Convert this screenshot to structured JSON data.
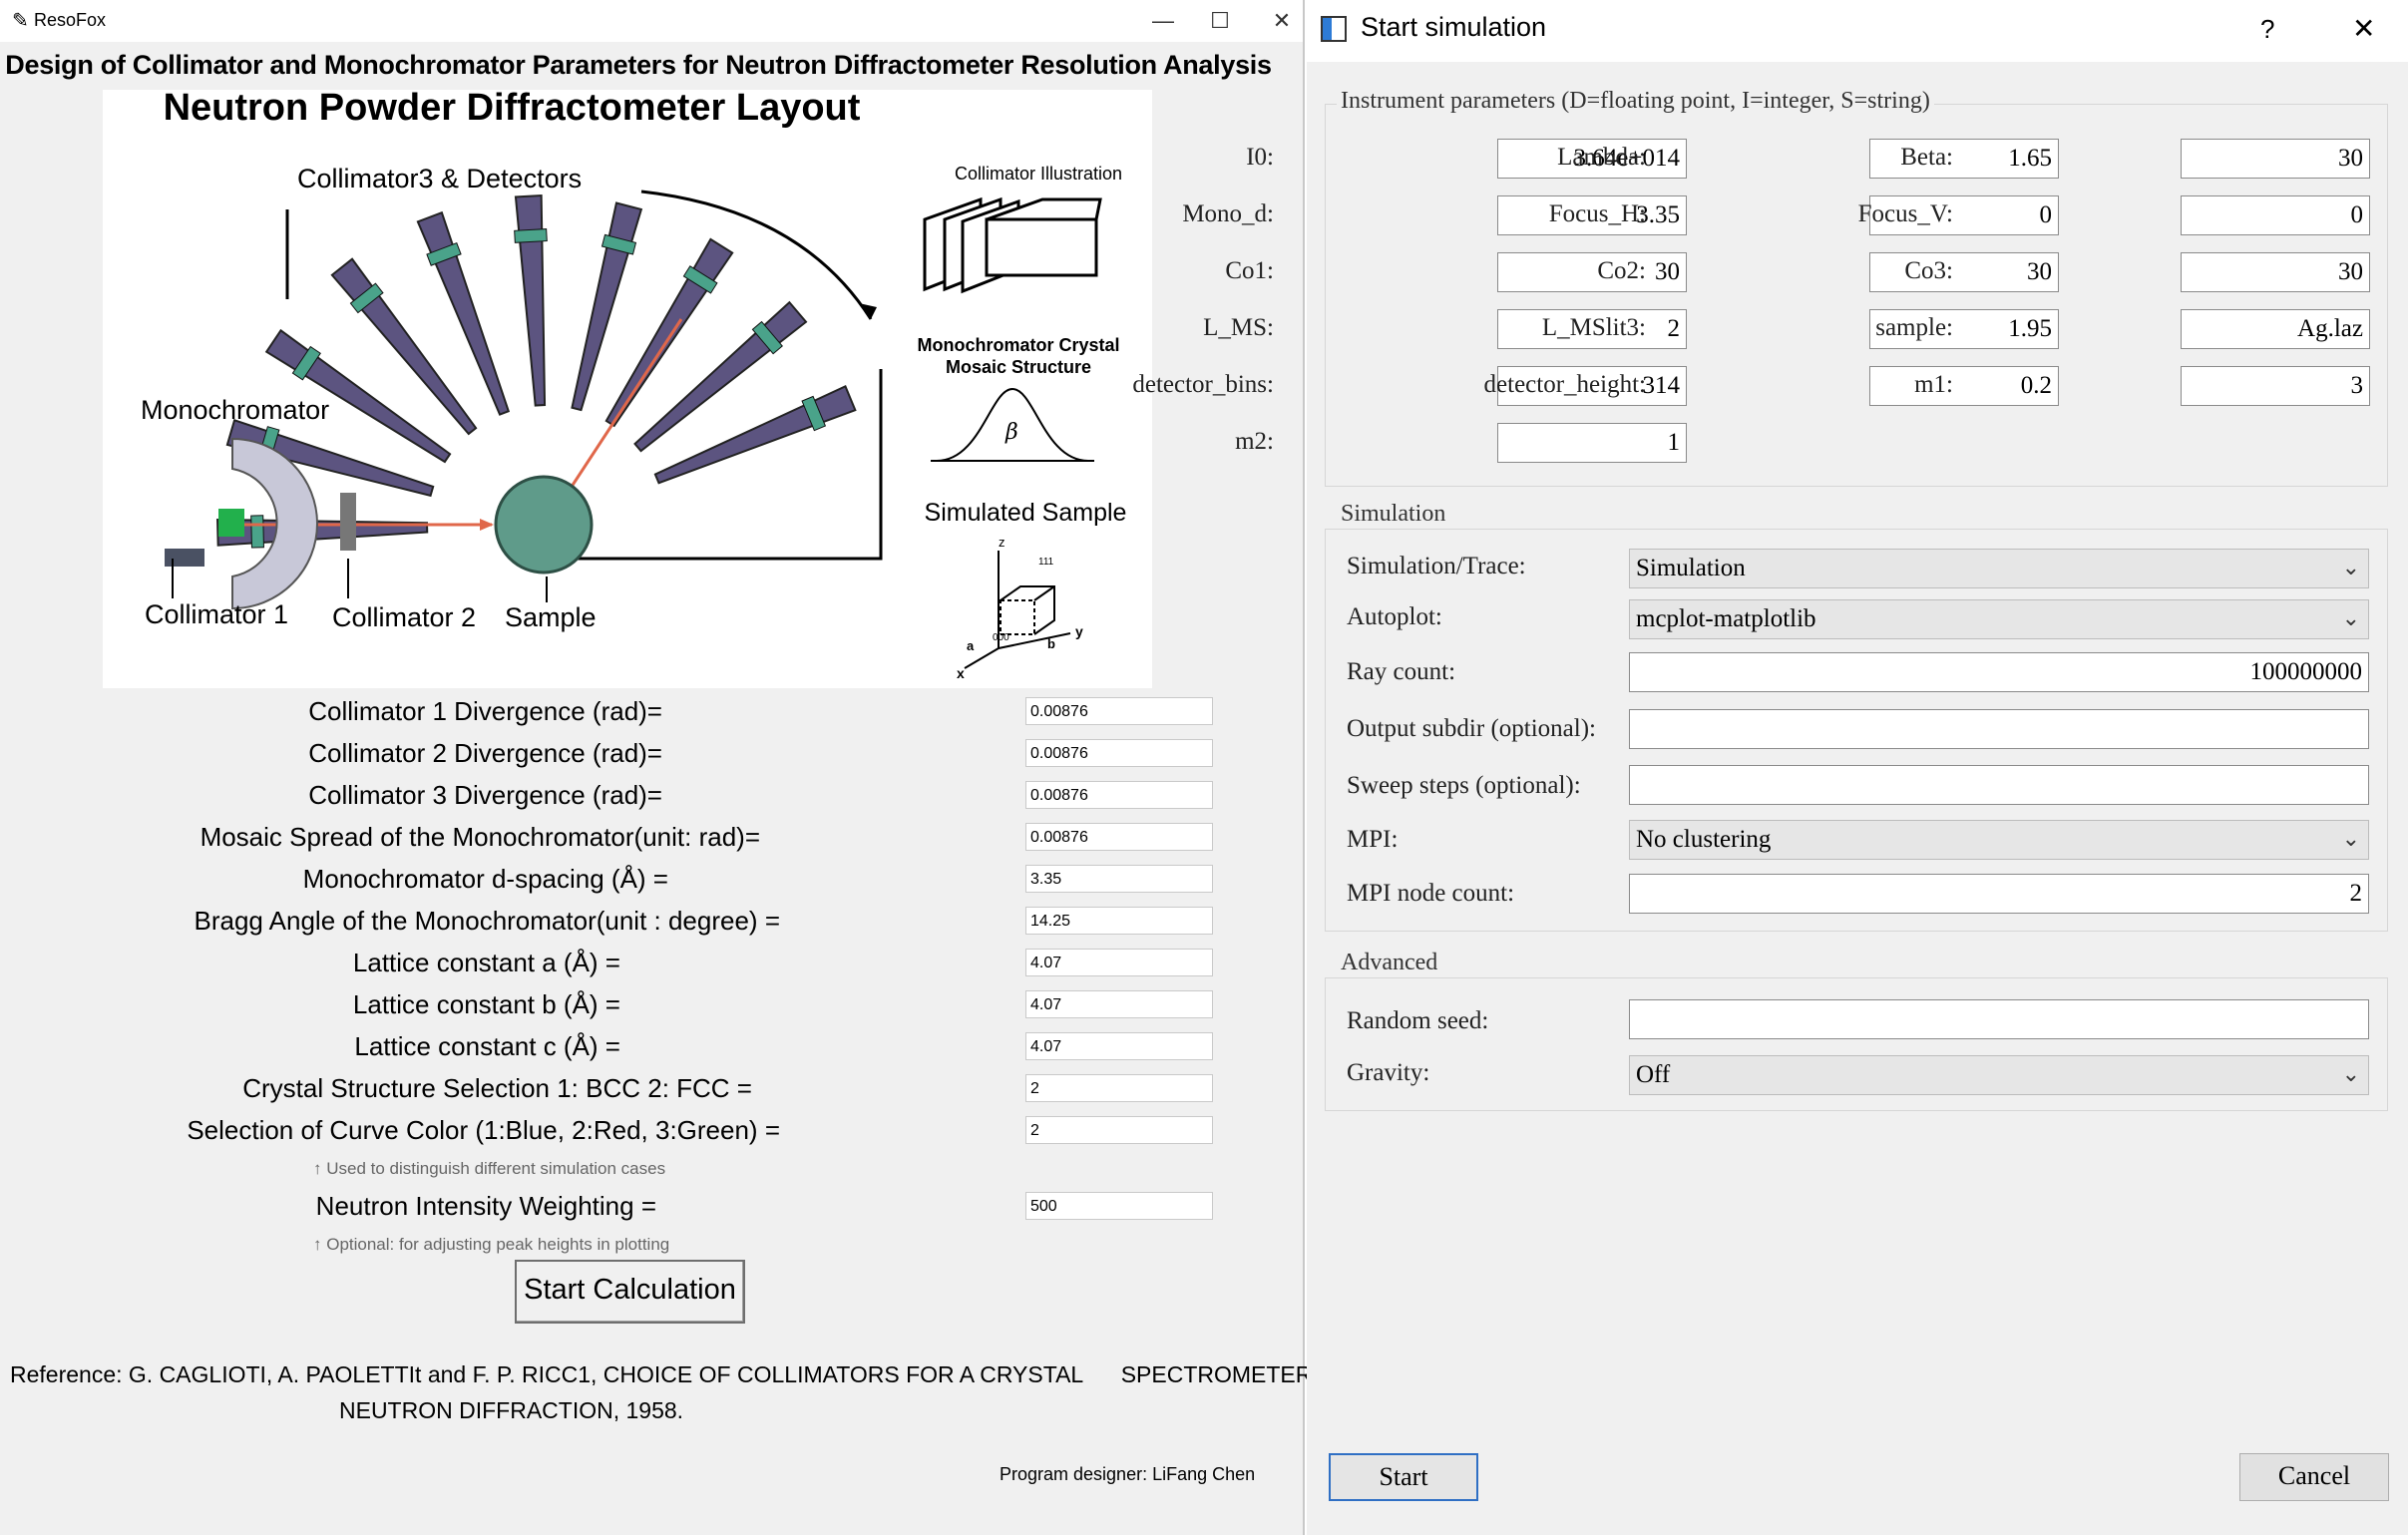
{
  "left_window": {
    "title": "ResoFox",
    "heading": "Design of Collimator and Monochromator Parameters for Neutron Diffractometer Resolution Analysis",
    "diagram": {
      "title": "Neutron Powder Diffractometer Layout",
      "collimator3_label": "Collimator3 & Detectors",
      "monochromator_label": "Monochromator",
      "collimator1_label": "Collimator 1",
      "collimator2_label": "Collimator 2",
      "sample_label": "Sample",
      "collimator_illustration_label": "Collimator Illustration",
      "mosaic_label_line1": "Monochromator Crystal",
      "mosaic_label_line2": "Mosaic Structure",
      "beta_symbol": "β",
      "simulated_sample_label": "Simulated Sample",
      "axis_z": "z",
      "axis_y": "y",
      "axis_x": "x",
      "axis_a": "a",
      "axis_b": "b",
      "miller_111": "111",
      "miller_000": "000"
    },
    "params": [
      {
        "label": "Collimator 1 Divergence (rad)=",
        "value": "0.00876"
      },
      {
        "label": "Collimator 2 Divergence (rad)=",
        "value": "0.00876"
      },
      {
        "label": "Collimator 3 Divergence (rad)=",
        "value": "0.00876"
      },
      {
        "label": "Mosaic Spread of the Monochromator(unit: rad)=",
        "value": "0.00876"
      },
      {
        "label": "Monochromator d-spacing (Å) =",
        "value": "3.35"
      },
      {
        "label": "Bragg Angle of the Monochromator(unit : degree) =",
        "value": "14.25"
      },
      {
        "label": "Lattice constant a (Å) =",
        "value": "4.07"
      },
      {
        "label": "Lattice constant b (Å) =",
        "value": "4.07"
      },
      {
        "label": "Lattice constant c (Å) =",
        "value": "4.07"
      },
      {
        "label": "Crystal Structure Selection  1: BCC   2: FCC  =",
        "value": "2"
      },
      {
        "label": "Selection of Curve Color (1:Blue, 2:Red, 3:Green) =",
        "value": "2"
      }
    ],
    "curve_note": "↑ Used to distinguish different simulation cases",
    "intensity": {
      "label": "Neutron Intensity Weighting =",
      "value": "500"
    },
    "intensity_note": "↑ Optional: for adjusting peak heights in plotting",
    "start_button": "Start Calculation",
    "reference_line1": "Reference: G. CAGLIOTI, A. PAOLETTIt and F. P. RICC1, CHOICE OF COLLIMATORS FOR A CRYSTAL      SPECTROMETER FOR",
    "reference_line2": "NEUTRON DIFFRACTION, 1958.",
    "designer": "Program designer: LiFang Chen"
  },
  "dialog": {
    "title": "Start simulation",
    "help_glyph": "?",
    "close_glyph": "✕",
    "instrument_group": "Instrument parameters (D=floating point, I=integer, S=string)",
    "instrument_params": [
      {
        "label": "I0:",
        "value": "3.64e+014"
      },
      {
        "label": "Lambda:",
        "value": "1.65"
      },
      {
        "label": "Beta:",
        "value": "30"
      },
      {
        "label": "Mono_d:",
        "value": "3.35"
      },
      {
        "label": "Focus_H:",
        "value": "0"
      },
      {
        "label": "Focus_V:",
        "value": "0"
      },
      {
        "label": "Co1:",
        "value": "30"
      },
      {
        "label": "Co2:",
        "value": "30"
      },
      {
        "label": "Co3:",
        "value": "30"
      },
      {
        "label": "L_MS:",
        "value": "2"
      },
      {
        "label": "L_MSlit3:",
        "value": "1.95"
      },
      {
        "label": "sample:",
        "value": "Ag.laz"
      },
      {
        "label": "detector_bins:",
        "value": "314"
      },
      {
        "label": "detector_height:",
        "value": "0.2"
      },
      {
        "label": "m1:",
        "value": "3"
      },
      {
        "label": "m2:",
        "value": "1"
      }
    ],
    "simulation_group": "Simulation",
    "simulation_fields": [
      {
        "label": "Simulation/Trace:",
        "value": "Simulation",
        "kind": "combo"
      },
      {
        "label": "Autoplot:",
        "value": "mcplot-matplotlib",
        "kind": "combo"
      },
      {
        "label": "Ray count:",
        "value": "100000000",
        "kind": "edit"
      },
      {
        "label": "Output subdir (optional):",
        "value": "",
        "kind": "edit"
      },
      {
        "label": "Sweep steps (optional):",
        "value": "",
        "kind": "edit"
      },
      {
        "label": "MPI:",
        "value": "No clustering",
        "kind": "combo"
      },
      {
        "label": "MPI node count:",
        "value": "2",
        "kind": "edit"
      }
    ],
    "advanced_group": "Advanced",
    "advanced_fields": [
      {
        "label": "Random seed:",
        "value": "",
        "kind": "edit"
      },
      {
        "label": "Gravity:",
        "value": "Off",
        "kind": "combo"
      }
    ],
    "start_button": "Start",
    "cancel_button": "Cancel"
  }
}
